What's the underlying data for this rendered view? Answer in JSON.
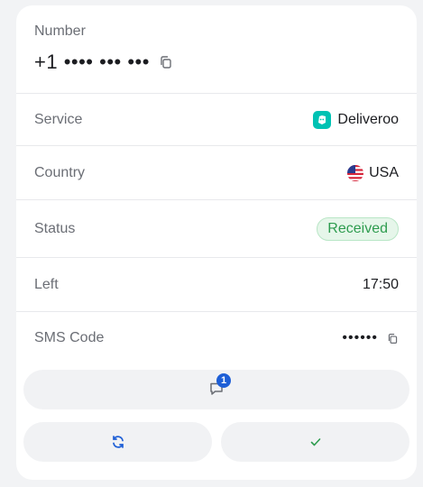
{
  "number": {
    "label": "Number",
    "value": "+1 •••• ••• •••",
    "copy_icon": "copy-icon"
  },
  "details": {
    "service": {
      "label": "Service",
      "value": "Deliveroo",
      "icon": "deliveroo-logo",
      "brand_color": "#00c2b3"
    },
    "country": {
      "label": "Country",
      "value": "USA",
      "icon": "us-flag-icon"
    },
    "status": {
      "label": "Status",
      "value": "Received",
      "color": "#2e9c4f",
      "background": "#e6f6ea"
    },
    "left": {
      "label": "Left",
      "value": "17:50"
    },
    "sms_code": {
      "label": "SMS Code",
      "value": "••••••",
      "copy_icon": "copy-icon"
    }
  },
  "actions": {
    "messages": {
      "icon": "chat-icon",
      "badge_count": "1"
    },
    "refresh": {
      "icon": "refresh-icon"
    },
    "confirm": {
      "icon": "check-icon"
    }
  },
  "colors": {
    "accent_blue": "#1e5fd6",
    "success_green": "#2e9c4f",
    "page_bg": "#f2f3f5",
    "card_bg": "#ffffff"
  }
}
